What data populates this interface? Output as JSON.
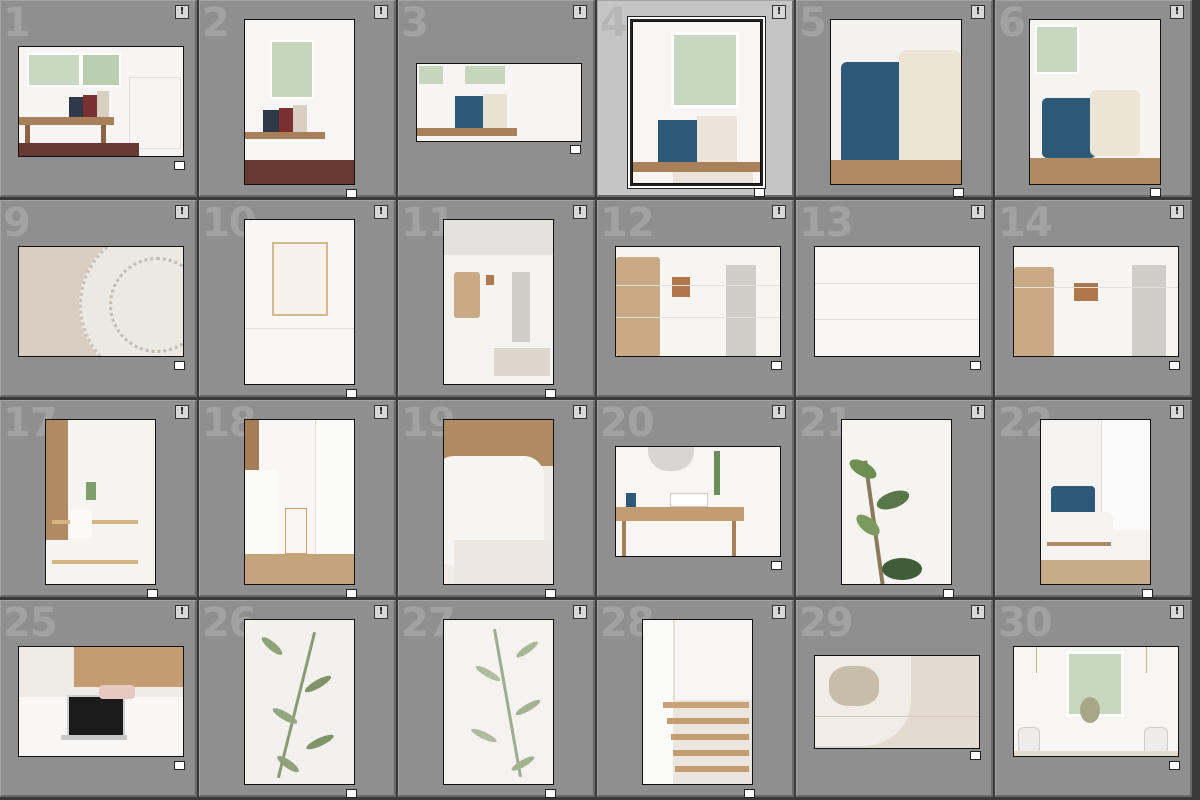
{
  "grid": {
    "cells": [
      {
        "label": "1",
        "flag": "!",
        "scene": "entry-bench-rug"
      },
      {
        "label": "2",
        "flag": "!",
        "scene": "entry-bench-tall"
      },
      {
        "label": "3",
        "flag": "!",
        "scene": "bench-pillows-wide"
      },
      {
        "label": "4",
        "flag": "!",
        "scene": "window-pillows",
        "selected": true
      },
      {
        "label": "5",
        "flag": "!",
        "scene": "pillows-closeup"
      },
      {
        "label": "6",
        "flag": "!",
        "scene": "pillows-window-bench"
      },
      {
        "label": "9",
        "flag": "!",
        "scene": "lace-on-wood"
      },
      {
        "label": "10",
        "flag": "!",
        "scene": "wall-frame"
      },
      {
        "label": "11",
        "flag": "!",
        "scene": "hooks-wall-tall"
      },
      {
        "label": "12",
        "flag": "!",
        "scene": "hooks-wall"
      },
      {
        "label": "13",
        "flag": "!",
        "scene": "shiplap-blank"
      },
      {
        "label": "14",
        "flag": "!",
        "scene": "hooks-wall-alt"
      },
      {
        "label": "17",
        "flag": "!",
        "scene": "bar-cart"
      },
      {
        "label": "18",
        "flag": "!",
        "scene": "bedroom-door"
      },
      {
        "label": "19",
        "flag": "!",
        "scene": "bedding-carved"
      },
      {
        "label": "20",
        "flag": "!",
        "scene": "console-mirror"
      },
      {
        "label": "21",
        "flag": "!",
        "scene": "fig-branch"
      },
      {
        "label": "22",
        "flag": "!",
        "scene": "rocking-chair"
      },
      {
        "label": "25",
        "flag": "!",
        "scene": "bed-laptop"
      },
      {
        "label": "26",
        "flag": "!",
        "scene": "olive-branch"
      },
      {
        "label": "27",
        "flag": "!",
        "scene": "olive-branch-light"
      },
      {
        "label": "28",
        "flag": "!",
        "scene": "staircase"
      },
      {
        "label": "29",
        "flag": "!",
        "scene": "dried-flowers-bowl"
      },
      {
        "label": "30",
        "flag": "!",
        "scene": "window-vases"
      }
    ]
  },
  "colors": {
    "cell": "#8f8f8f",
    "cell_selected": "#c5c5c5",
    "number": "#a2a2a2",
    "wood": "#b08a62",
    "navy_pillow": "#2d5a78",
    "cream": "#ece4d8"
  }
}
